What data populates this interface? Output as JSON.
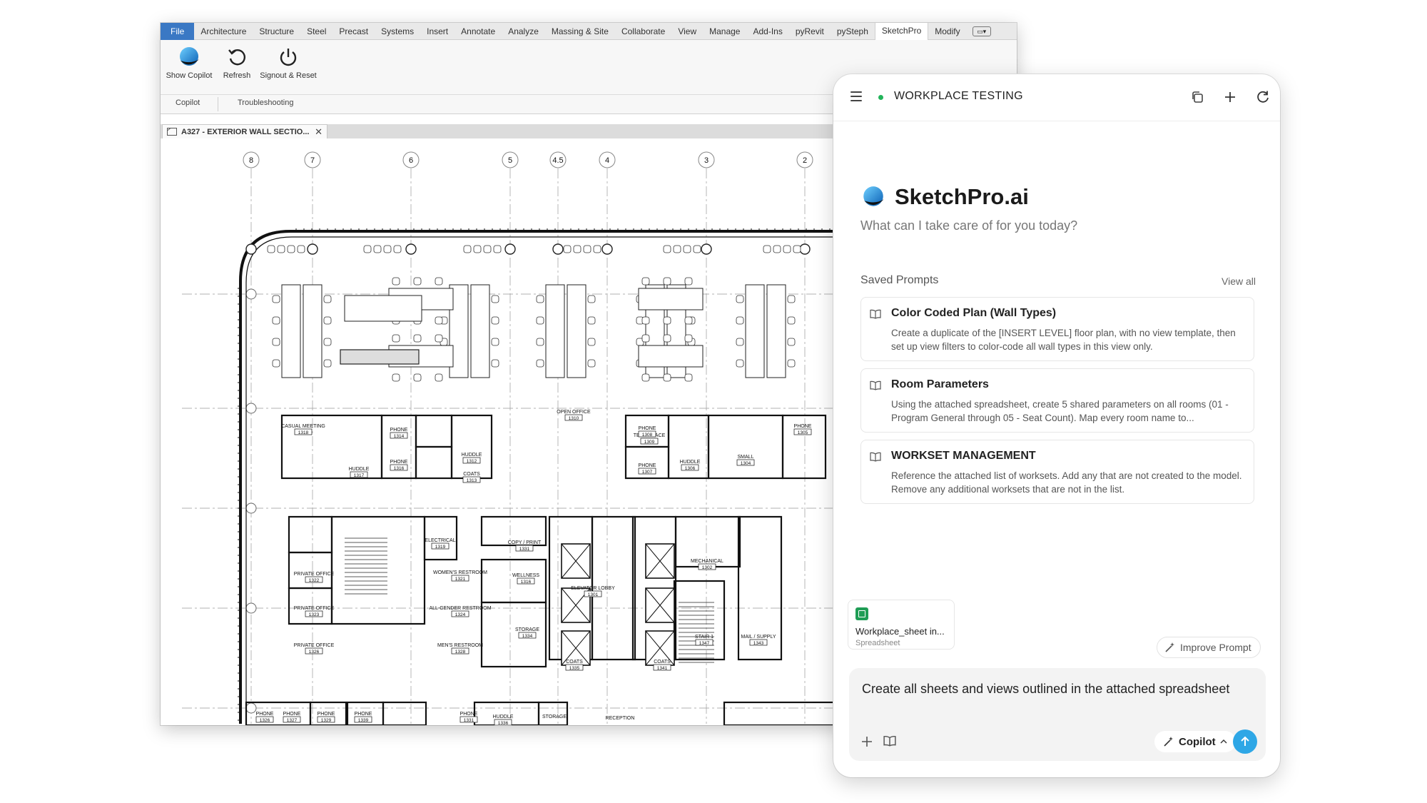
{
  "app": {
    "menu": [
      "File",
      "Architecture",
      "Structure",
      "Steel",
      "Precast",
      "Systems",
      "Insert",
      "Annotate",
      "Analyze",
      "Massing & Site",
      "Collaborate",
      "View",
      "Manage",
      "Add-Ins",
      "pyRevit",
      "pySteph",
      "SketchPro",
      "Modify"
    ],
    "active_menu": "SketchPro",
    "ribbon": {
      "buttons": [
        {
          "label": "Show Copilot",
          "icon": "copilot-logo-icon"
        },
        {
          "label": "Refresh",
          "icon": "refresh-icon"
        },
        {
          "label": "Signout & Reset",
          "icon": "power-icon"
        }
      ],
      "groups": [
        "Copilot",
        "Troubleshooting"
      ]
    },
    "view_tab": {
      "label": "A327 - EXTERIOR WALL SECTIO...",
      "icon": "view-icon"
    },
    "drawing": {
      "grid_labels": [
        "8",
        "7",
        "6",
        "5",
        "4.5",
        "4",
        "3",
        "2"
      ],
      "rooms": [
        {
          "name": "CASUAL MEETING",
          "num": "1318"
        },
        {
          "name": "HUDDLE",
          "num": "1317"
        },
        {
          "name": "PHONE",
          "num": "1314"
        },
        {
          "name": "PHONE",
          "num": "1316"
        },
        {
          "name": "HUDDLE",
          "num": "1312"
        },
        {
          "name": "COATS",
          "num": "1313"
        },
        {
          "name": "OPEN OFFICE",
          "num": "1310"
        },
        {
          "name": "TEAM SPACE",
          "num": "1309"
        },
        {
          "name": "PHONE",
          "num": "1308"
        },
        {
          "name": "PHONE",
          "num": "1307"
        },
        {
          "name": "HUDDLE",
          "num": "1306"
        },
        {
          "name": "SMALL",
          "num": "1304"
        },
        {
          "name": "PHONE",
          "num": "1305"
        },
        {
          "name": "ELECTRICAL",
          "num": "1319"
        },
        {
          "name": "PRIVATE OFFICE",
          "num": "1322"
        },
        {
          "name": "WOMEN'S RESTROOM",
          "num": "1321"
        },
        {
          "name": "COPY / PRINT",
          "num": "1331"
        },
        {
          "name": "WELLNESS",
          "num": "1316"
        },
        {
          "name": "ELEVATOR LOBBY",
          "num": "1301"
        },
        {
          "name": "MECHANICAL",
          "num": "1302"
        },
        {
          "name": "PRIVATE OFFICE",
          "num": "1323"
        },
        {
          "name": "ALL-GENDER RESTROOM",
          "num": "1324"
        },
        {
          "name": "STORAGE",
          "num": "1334"
        },
        {
          "name": "MAIL / SUPPLY",
          "num": "1343"
        },
        {
          "name": "PRIVATE OFFICE",
          "num": "1326"
        },
        {
          "name": "MEN'S RESTROOM",
          "num": "1328"
        },
        {
          "name": "COATS",
          "num": "1335"
        },
        {
          "name": "COATS",
          "num": "1341"
        },
        {
          "name": "STAIR 1",
          "num": "1347"
        },
        {
          "name": "PHONE",
          "num": "1326"
        },
        {
          "name": "PHONE",
          "num": "1327"
        },
        {
          "name": "PHONE",
          "num": "1329"
        },
        {
          "name": "PHONE",
          "num": "1339"
        },
        {
          "name": "PHONE",
          "num": "1331"
        },
        {
          "name": "HUDDLE",
          "num": "1336"
        },
        {
          "name": "STORAGE",
          "num": ""
        },
        {
          "name": "RECEPTION",
          "num": ""
        }
      ]
    }
  },
  "panel": {
    "title": "WORKPLACE TESTING",
    "status_color": "#22b45a",
    "brand": "SketchPro.ai",
    "subtitle": "What can I take care of for you today?",
    "saved_prompts_label": "Saved Prompts",
    "view_all": "View all",
    "prompts": [
      {
        "title": "Color Coded Plan (Wall Types)",
        "desc": "Create a duplicate of the [INSERT LEVEL] floor plan, with no view template, then set up view filters to color-code all wall types in this view only."
      },
      {
        "title": "Room Parameters",
        "desc": "Using the attached spreadsheet, create 5 shared parameters on all rooms (01 - Program General through 05 - Seat Count). Map every room name to..."
      },
      {
        "title": "WORKSET MANAGEMENT",
        "desc": "Reference the attached list of worksets. Add any that are not created to the model. Remove any additional worksets that are not in the list."
      }
    ],
    "attachment": {
      "name": "Workplace_sheet in...",
      "type": "Spreadsheet"
    },
    "improve_label": "Improve Prompt",
    "composer_text": "Create all sheets and views outlined in the attached spreadsheet",
    "mode_label": "Copilot",
    "accent": "#2ea7e6"
  }
}
